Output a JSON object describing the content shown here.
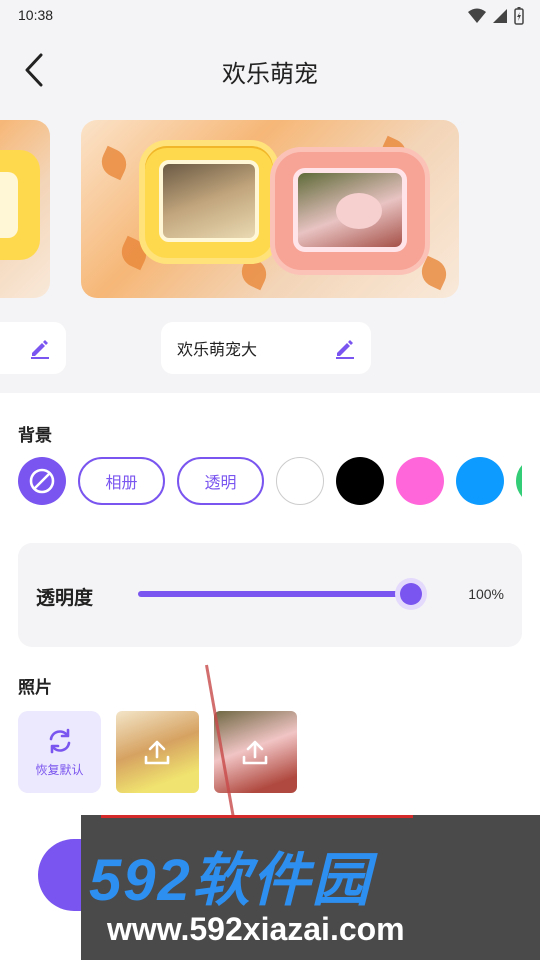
{
  "status": {
    "time": "10:38"
  },
  "header": {
    "title": "欢乐萌宠"
  },
  "templates": [
    {
      "name": ""
    },
    {
      "name": "欢乐萌宠大"
    }
  ],
  "background": {
    "label": "背景",
    "options": {
      "album": "相册",
      "transparent": "透明"
    },
    "swatches": [
      "#ffffff",
      "#000000",
      "#ff66d9",
      "#0d9bff",
      "#33cc77"
    ]
  },
  "opacity": {
    "label": "透明度",
    "value": "100%",
    "level": 1.0
  },
  "photos": {
    "label": "照片",
    "reset_label": "恢复默认"
  },
  "watermark": {
    "brand": "592软件园",
    "url": "www.592xiazai.com"
  },
  "colors": {
    "accent": "#7a55ef"
  }
}
